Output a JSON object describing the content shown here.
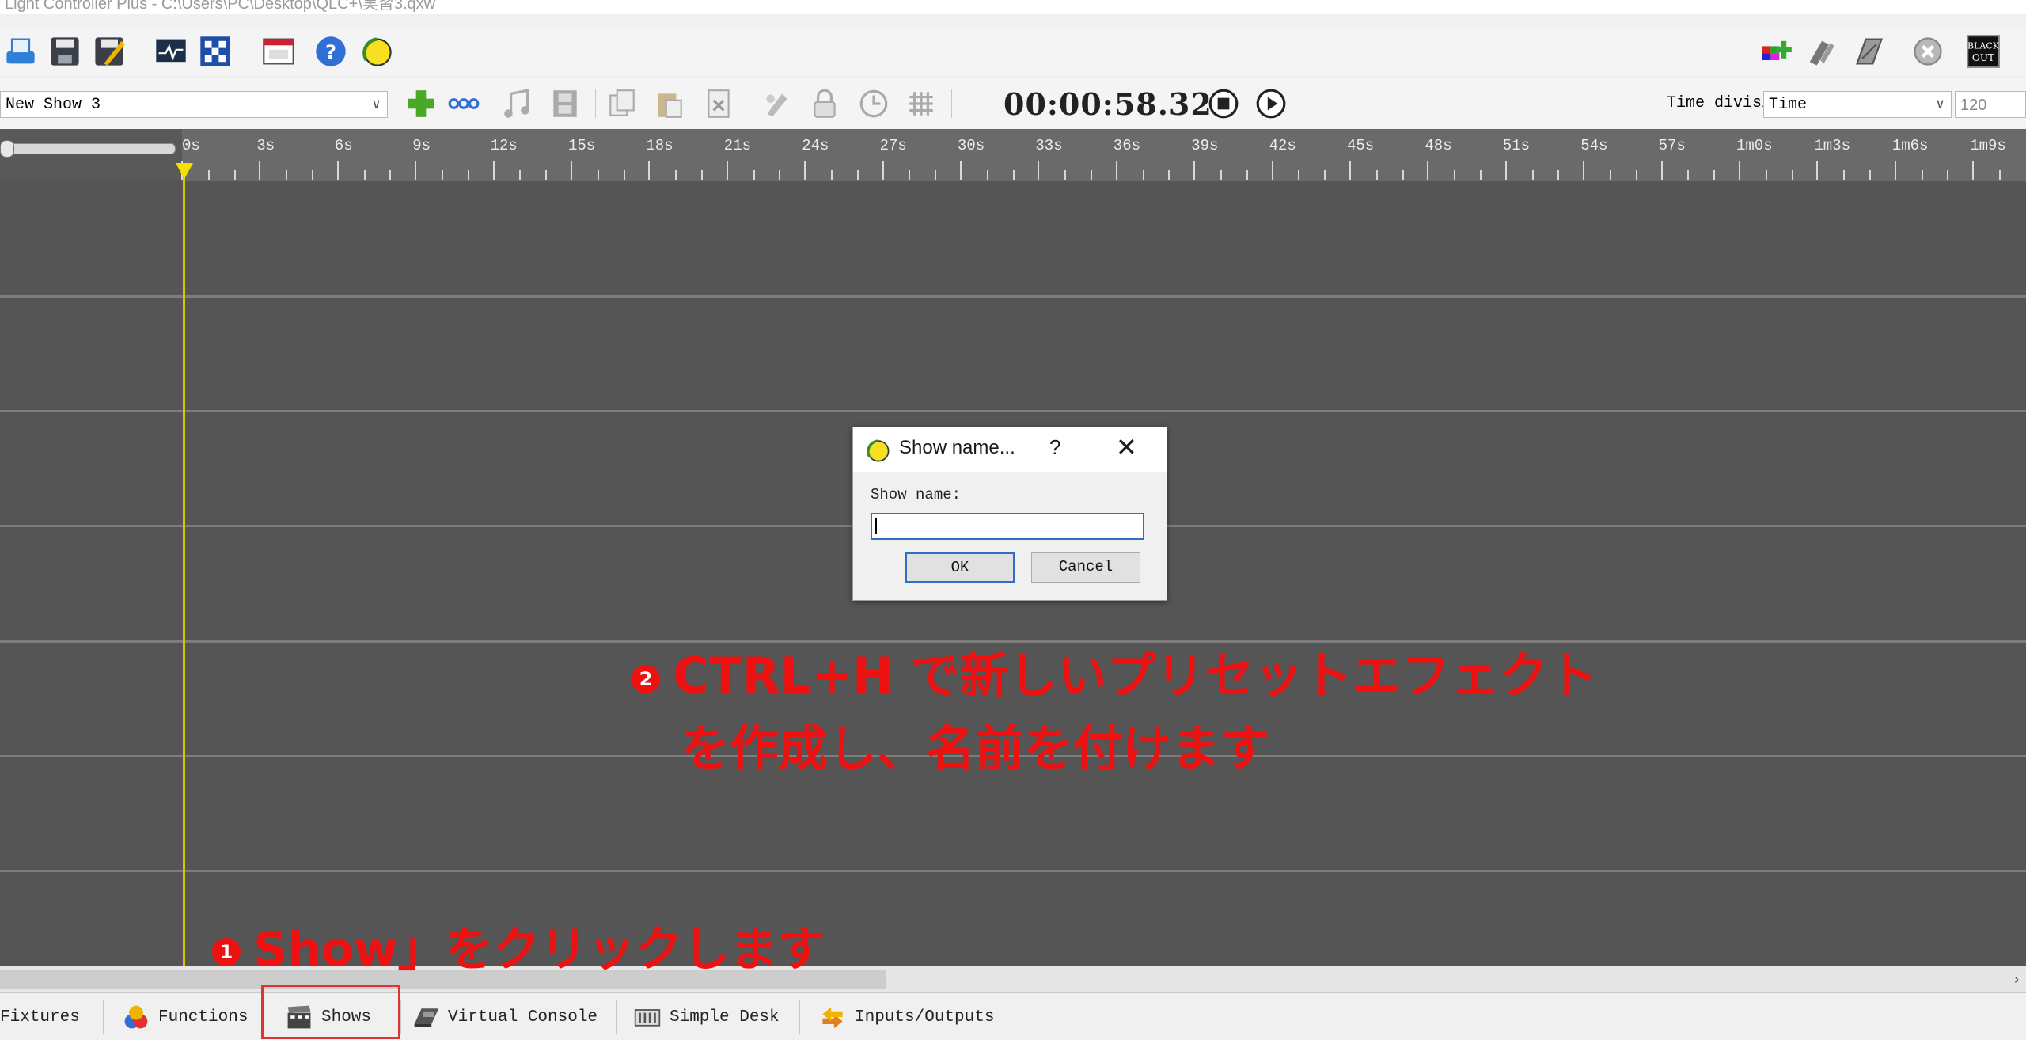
{
  "window": {
    "title": "Light Controller Plus - C:\\Users\\PC\\Desktop\\QLC+\\実習3.qxw",
    "title_visible_fragment": "Light Controller Plus - C:\\Users\\PC\\Desktop\\QLC+\\実習3.qxw"
  },
  "toolbar_main": {
    "left_icons": [
      "new-icon",
      "save-icon",
      "save-as-icon",
      "monitor-icon",
      "address-tool-icon",
      "fullscreen-icon",
      "help-icon",
      "about-icon"
    ],
    "right_icons": [
      "live-edit-icon",
      "operate-mode-icon",
      "design-mode-icon",
      "stop-all-icon",
      "blackout-icon"
    ],
    "blackout_label_1": "BLACK",
    "blackout_label_2": "OUT"
  },
  "show_toolbar": {
    "show_select_value": "New Show 3",
    "icons": [
      "add-track-icon",
      "add-sequence-icon",
      "add-audio-icon",
      "add-video-icon",
      "copy-icon",
      "paste-icon",
      "delete-icon",
      "color-icon",
      "lock-icon",
      "duration-icon",
      "grid-icon"
    ],
    "timer": "00:00:58.32",
    "time_division_label": "Time division:",
    "time_division_value": "Time",
    "bpm_value": "120"
  },
  "ruler": {
    "labels": [
      "0s",
      "3s",
      "6s",
      "9s",
      "12s",
      "15s",
      "18s",
      "21s",
      "24s",
      "27s",
      "30s",
      "33s",
      "36s",
      "39s",
      "42s",
      "45s",
      "48s",
      "51s",
      "54s",
      "57s",
      "1m0s",
      "1m3s",
      "1m6s",
      "1m9s"
    ]
  },
  "dialog": {
    "title": "Show name...",
    "help": "?",
    "close": "✕",
    "label": "Show name:",
    "input_value": "",
    "ok_label": "OK",
    "cancel_label": "Cancel"
  },
  "tabs": [
    {
      "label": "Fixtures",
      "icon": "fixtures-icon"
    },
    {
      "label": "Functions",
      "icon": "functions-icon"
    },
    {
      "label": "Shows",
      "icon": "shows-icon",
      "active": true
    },
    {
      "label": "Virtual Console",
      "icon": "virtual-console-icon"
    },
    {
      "label": "Simple Desk",
      "icon": "simple-desk-icon"
    },
    {
      "label": "Inputs/Outputs",
      "icon": "inputs-outputs-icon"
    }
  ],
  "annotations": {
    "step1_number": "1",
    "step1_text": "Show」をクリックします",
    "step2_number": "2",
    "step2_line1": "CTRL+H で新しいプリセットエフェクト",
    "step2_line2": "を作成し、名前を付けます"
  },
  "colors": {
    "annotation_red": "#ee1111",
    "timeline_bg": "#555555",
    "cursor_yellow": "#f2e100",
    "focus_blue": "#2f6fc4"
  }
}
